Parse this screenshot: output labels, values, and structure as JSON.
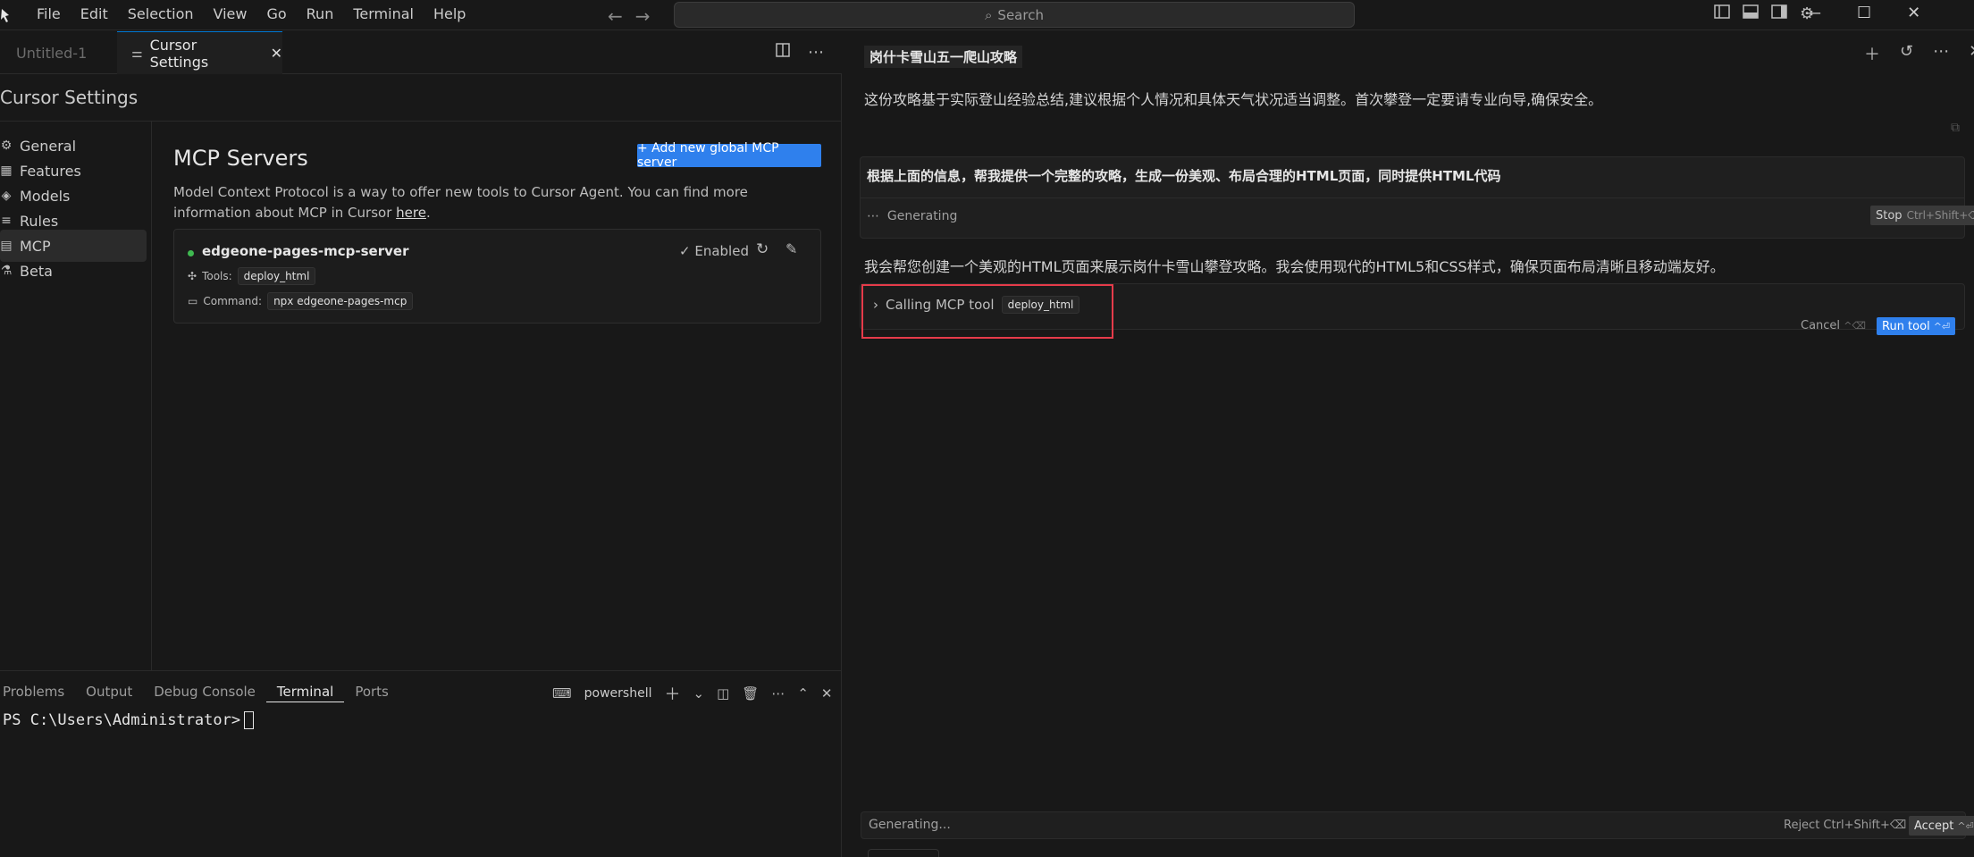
{
  "titlebar": {
    "menu": [
      "File",
      "Edit",
      "Selection",
      "View",
      "Go",
      "Run",
      "Terminal",
      "Help"
    ],
    "search_label": "Search"
  },
  "editor": {
    "tabs": [
      {
        "label": "Untitled-1"
      },
      {
        "label": "Cursor Settings"
      }
    ]
  },
  "settings": {
    "title": "Cursor Settings",
    "nav": [
      {
        "label": "General",
        "icon": "gear-icon"
      },
      {
        "label": "Features",
        "icon": "grid-icon"
      },
      {
        "label": "Models",
        "icon": "cube-icon"
      },
      {
        "label": "Rules",
        "icon": "list-icon"
      },
      {
        "label": "MCP",
        "icon": "server-icon",
        "active": true
      },
      {
        "label": "Beta",
        "icon": "flask-icon"
      }
    ],
    "mcp": {
      "heading": "MCP Servers",
      "add_button": "+ Add new global MCP server",
      "desc_part1": "Model Context Protocol is a way to offer new tools to Cursor Agent. You can find more information about MCP in Cursor ",
      "desc_link": "here",
      "desc_end": ".",
      "server": {
        "name": "edgeone-pages-mcp-server",
        "status": "Enabled",
        "tools_label": "Tools:",
        "tools_value": "deploy_html",
        "command_label": "Command:",
        "command_value": "npx edgeone-pages-mcp",
        "status_color": "#3fb950"
      }
    }
  },
  "panel": {
    "tabs": [
      "Problems",
      "Output",
      "Debug Console",
      "Terminal",
      "Ports"
    ],
    "active_tab": "Terminal",
    "shell": "powershell",
    "prompt": "PS C:\\Users\\Administrator>"
  },
  "chat": {
    "title": "岗什卡雪山五一爬山攻略",
    "intro": "这份攻略基于实际登山经验总结,建议根据个人情况和具体天气状况适当调整。首次攀登一定要请专业向导,确保安全。",
    "user_message": "根据上面的信息，帮我提供一个完整的攻略，生成一份美观、布局合理的HTML页面，同时提供HTML代码",
    "generating": "Generating",
    "stop_label": "Stop",
    "stop_kbd": "Ctrl+Shift+⌫",
    "assistant_message": "我会帮您创建一个美观的HTML页面来展示岗什卡雪山攀登攻略。我会使用现代的HTML5和CSS样式，确保页面布局清晰且移动端友好。",
    "tool_call_label": "Calling MCP tool",
    "tool_name": "deploy_html",
    "cancel_label": "Cancel",
    "cancel_kbd": "^⌫",
    "run_label": "Run tool",
    "run_kbd": "^⏎",
    "bottom_status": "Generating...",
    "reject_label": "Reject Ctrl+Shift+⌫",
    "accept_label": "Accept",
    "accept_kbd": "^⏎",
    "accent_color": "#2f80ed",
    "highlight_color": "#e53b4a"
  }
}
